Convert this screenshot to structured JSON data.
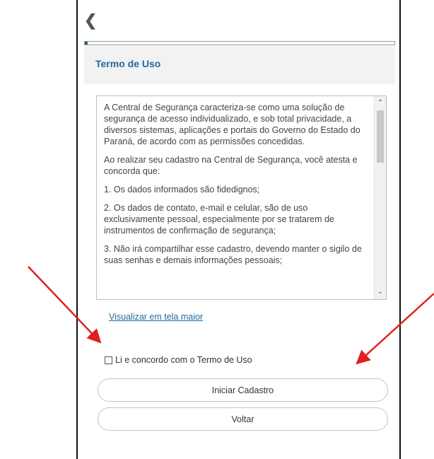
{
  "nav": {
    "back_icon": "chevron-left-icon",
    "back_glyph": "❮"
  },
  "progress": {
    "value": 0.01
  },
  "header": {
    "title": "Termo de Uso"
  },
  "terms": {
    "paragraphs": [
      "A Central de Segurança caracteriza-se como uma solução de segurança de acesso individualizado, e sob total privacidade, a diversos sistemas, aplicações e portais do Governo do Estado do Paraná, de acordo com as permissões concedidas.",
      "Ao realizar seu cadastro na Central de Segurança, você atesta e concorda que:",
      "1. Os dados informados são fidedignos;",
      "2. Os dados de contato, e-mail e celular, são de uso exclusivamente pessoal, especialmente por se tratarem de instrumentos de confirmação de segurança;",
      "3. Não irá compartilhar esse cadastro, devendo manter o sigilo de suas senhas e demais informações pessoais;"
    ],
    "scroll_up_glyph": "⌃",
    "scroll_down_glyph": "⌄"
  },
  "links": {
    "view_larger": "Visualizar em tela maior"
  },
  "agreement": {
    "label": "Li e concordo com o Termo de Uso",
    "checked": false
  },
  "buttons": {
    "start": "Iniciar Cadastro",
    "back": "Voltar"
  },
  "colors": {
    "accent": "#1f6aa0",
    "annotation_arrow": "#e02020"
  }
}
